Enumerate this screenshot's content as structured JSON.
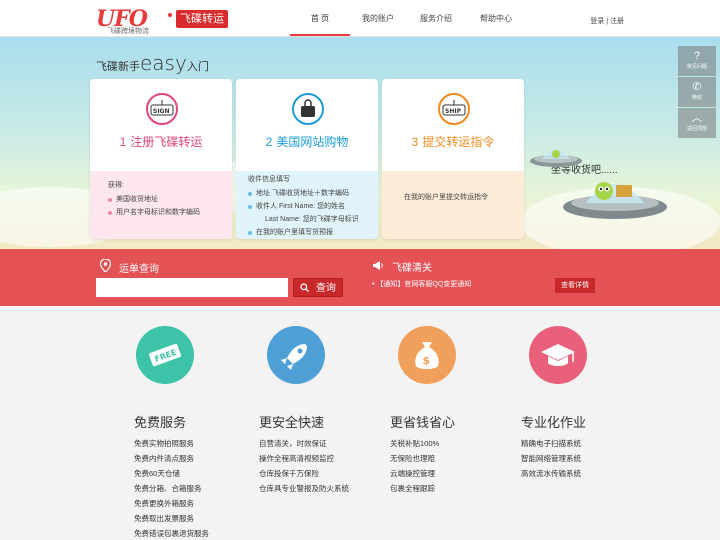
{
  "header": {
    "logo_text": "UFO",
    "logo_sub": "飞碟跨境物流",
    "brand": "飞碟转运",
    "nav": [
      "首 页",
      "我的账户",
      "服务介绍",
      "帮助中心"
    ],
    "login": "登录",
    "sep": " | ",
    "register": "注册"
  },
  "hero": {
    "title_pre": "飞碟新手",
    "title_easy": "easy",
    "title_post": "入门",
    "waiting": "坐等收货吧......",
    "cards": [
      {
        "num": "1",
        "title": "注册飞碟转运",
        "icon_text": "SIGN",
        "lead": "获得:",
        "items": [
          "美国收货地址",
          "用户名字母标识和数字编码"
        ]
      },
      {
        "num": "2",
        "title": "美国网站购物",
        "icon_text": "",
        "lead": "收件信息填写",
        "items": [
          "地址  飞碟收货地址＋数字编码",
          "收件人  First Name: 您的姓名",
          "Last Name: 您的飞碟字母标识",
          "在我的账户里填写货预报"
        ]
      },
      {
        "num": "3",
        "title": "提交转运指令",
        "icon_text": "SHIP",
        "lead": "",
        "items": [
          "在我的账户里提交转运指令"
        ]
      }
    ]
  },
  "side": [
    {
      "icon": "?",
      "label": "常见问题"
    },
    {
      "icon": "✆",
      "label": "微信"
    },
    {
      "icon": "︿",
      "label": "返回顶部"
    }
  ],
  "tracking": {
    "title": "运单查询",
    "placeholder": "",
    "button": "查询"
  },
  "notice": {
    "title": "飞碟清关",
    "item": "【通知】官网客服QQ变更通知",
    "button": "查看详情"
  },
  "features": [
    {
      "title": "免费服务",
      "items": [
        "免费实物拍照服务",
        "免费内件清点服务",
        "免费60天仓储",
        "免费分箱、合箱服务",
        "免费更换外箱服务",
        "免费取出发票服务",
        "免费错误包裹退货服务"
      ]
    },
    {
      "title": "更安全快速",
      "items": [
        "自营清关，时效保证",
        "操作全程高清视频监控",
        "仓库投保千万保险",
        "仓库具专业警报及防火系统"
      ]
    },
    {
      "title": "更省钱省心",
      "items": [
        "关税补贴100%",
        "无保险也理赔",
        "云端操控管理",
        "包裹全程跟踪"
      ]
    },
    {
      "title": "专业化作业",
      "items": [
        "精确电子扫描系统",
        "智能网络管理系统",
        "高效流水传输系统"
      ]
    }
  ],
  "colors": {
    "accent": "#e83a3a",
    "band": "#e55255",
    "pink": "#e0457b",
    "blue": "#1a9bd7",
    "orange": "#f08a1d"
  }
}
